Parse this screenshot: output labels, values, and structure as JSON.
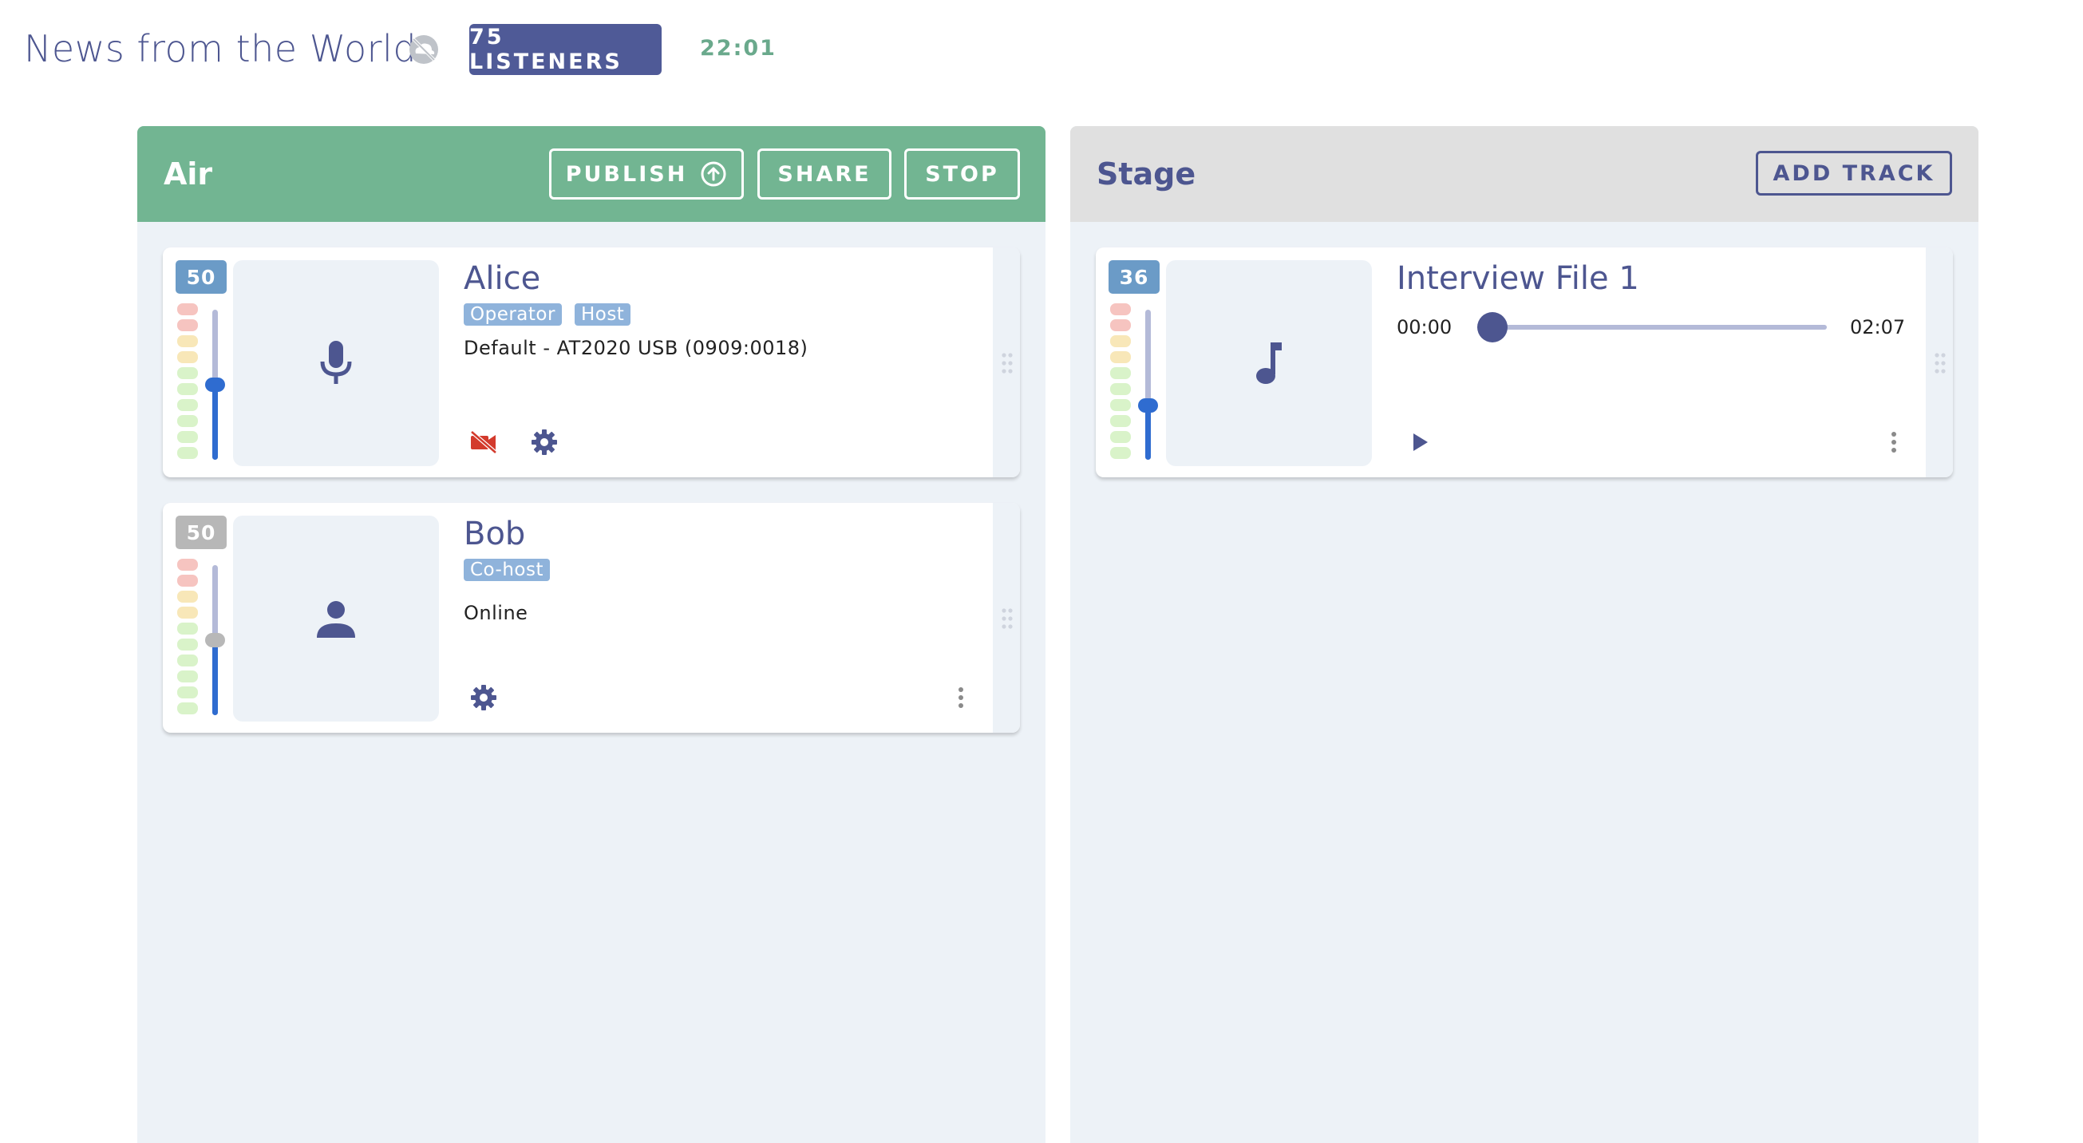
{
  "header": {
    "title": "News from the World",
    "listeners_label": "75 LISTENERS",
    "clock": "22:01",
    "offline_icon": "cloud-off-icon"
  },
  "air": {
    "title": "Air",
    "buttons": {
      "publish": "PUBLISH",
      "share": "SHARE",
      "stop": "STOP"
    },
    "accent_color": "#72b592",
    "cards": [
      {
        "volume": "50",
        "name": "Alice",
        "tags": [
          "Operator",
          "Host"
        ],
        "status": "Default - AT2020 USB (0909:0018)",
        "avatar_icon": "microphone-icon",
        "actions": [
          "video-off-icon",
          "gear-icon"
        ],
        "slider_level": 0.5
      },
      {
        "volume": "50",
        "name": "Bob",
        "tags": [
          "Co-host"
        ],
        "status": "Online",
        "avatar_icon": "person-icon",
        "actions": [
          "gear-icon",
          "more-vert-icon"
        ],
        "slider_level": 0.5
      }
    ]
  },
  "stage": {
    "title": "Stage",
    "buttons": {
      "add_track": "ADD TRACK"
    },
    "cards": [
      {
        "volume": "36",
        "name": "Interview File 1",
        "time_current": "00:00",
        "time_total": "02:07",
        "progress": 0,
        "avatar_icon": "music-note-icon",
        "actions": [
          "play-icon",
          "more-vert-icon"
        ],
        "slider_level": 0.36
      }
    ]
  },
  "colors": {
    "primary": "#4d5690",
    "air": "#72b592",
    "stage_header": "#e0e0e0",
    "tag": "#8fb3db",
    "danger": "#d33a2c"
  }
}
